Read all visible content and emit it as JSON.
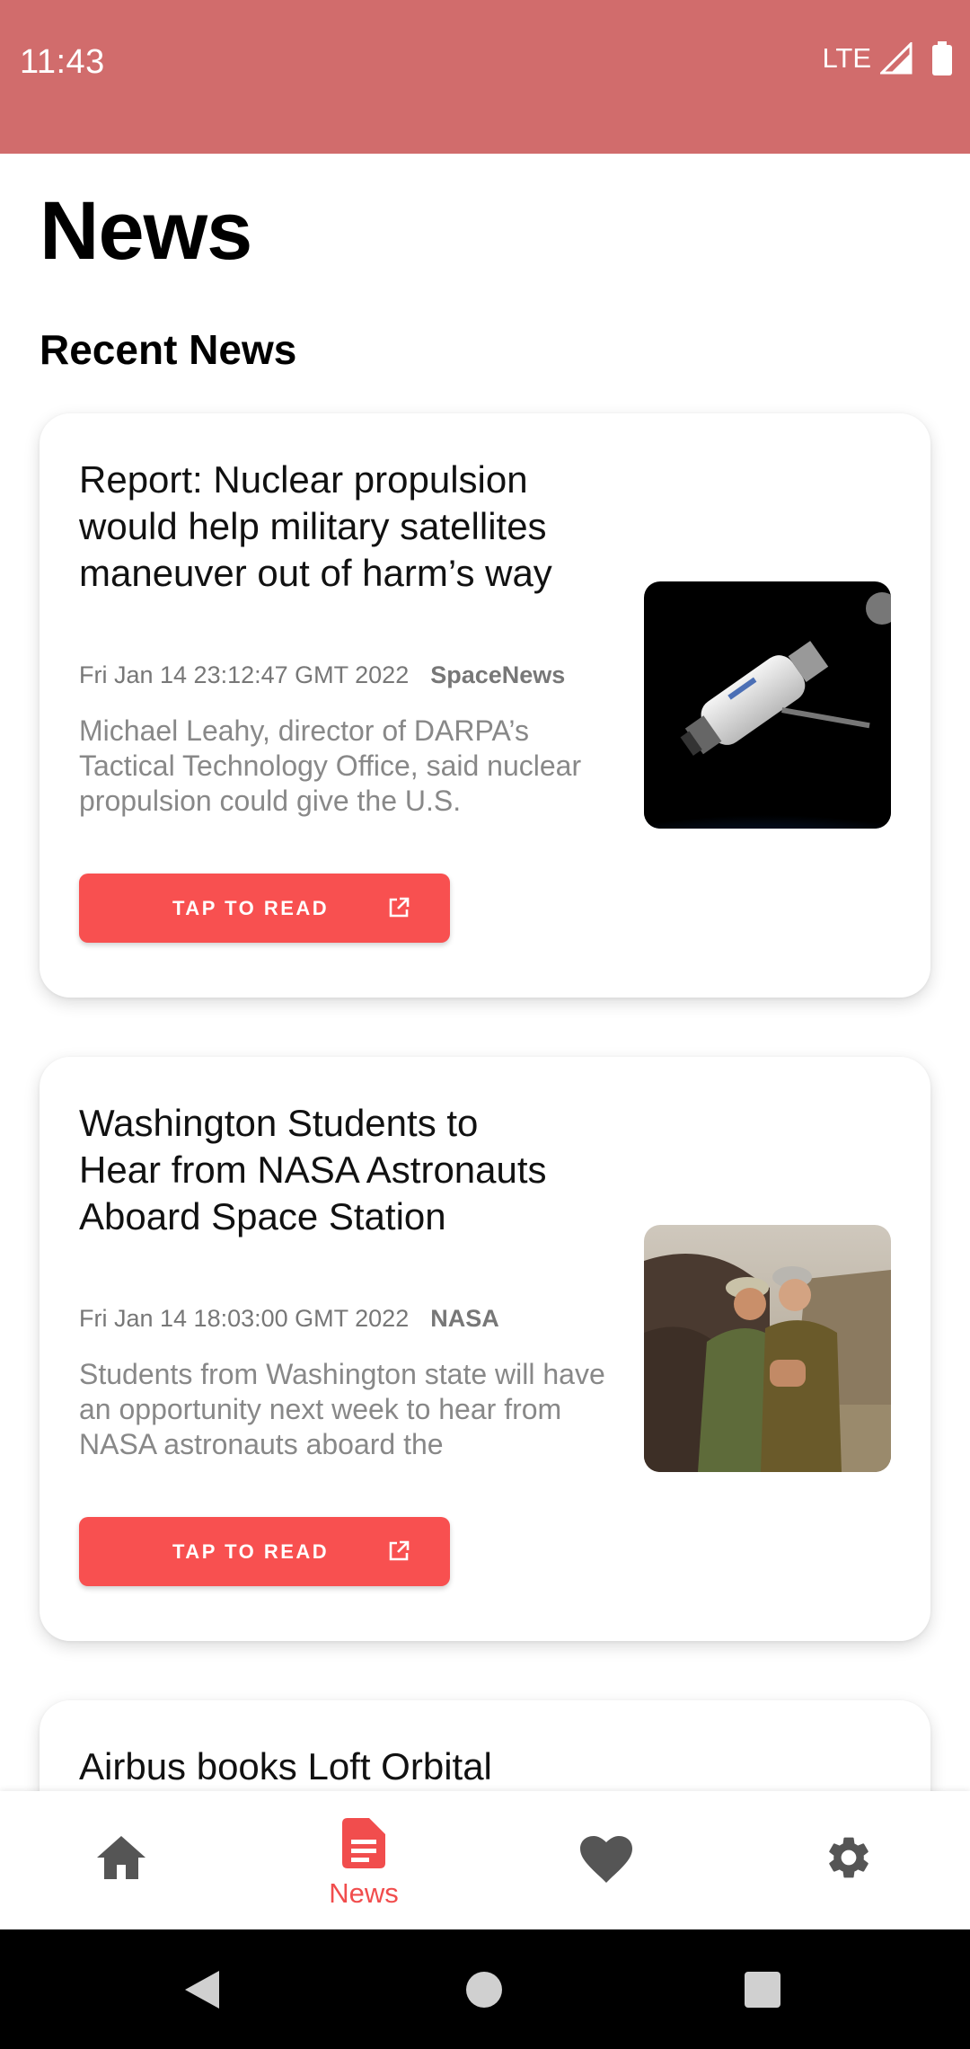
{
  "status_bar": {
    "time": "11:43",
    "network": "LTE"
  },
  "header": {
    "title": "News",
    "section": "Recent News"
  },
  "articles": [
    {
      "title": "Report: Nuclear propulsion would help military satellites maneuver out of harm’s way",
      "date": "Fri Jan 14 23:12:47 GMT 2022",
      "source": "SpaceNews",
      "summary": "Michael Leahy, director of DARPA’s Tactical Technology Office, said nuclear propulsion could give the U.S.",
      "button": "TAP TO READ"
    },
    {
      "title": "Washington Students to Hear from NASA Astronauts Aboard Space Station",
      "date": "Fri Jan 14 18:03:00 GMT 2022",
      "source": "NASA",
      "summary": "Students from Washington state will have an opportunity next week to hear from NASA astronauts aboard the",
      "button": "TAP TO READ"
    },
    {
      "title": "Airbus books Loft Orbital"
    }
  ],
  "bottom_nav": {
    "items": [
      {
        "icon": "home-icon",
        "label": ""
      },
      {
        "icon": "news-icon",
        "label": "News",
        "active": true
      },
      {
        "icon": "heart-icon",
        "label": ""
      },
      {
        "icon": "gear-icon",
        "label": ""
      }
    ],
    "active_color": "#f14d4d",
    "inactive_color": "#555555"
  },
  "colors": {
    "status_bar": "#d16c6c",
    "accent": "#f85050"
  }
}
